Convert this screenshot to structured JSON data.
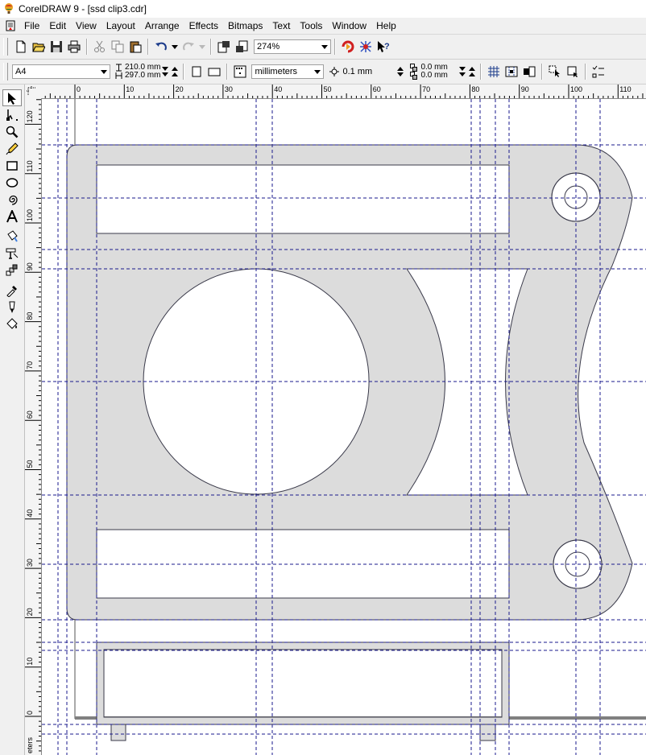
{
  "window": {
    "title": "CorelDRAW 9 - [ssd clip3.cdr]"
  },
  "menu": [
    "File",
    "Edit",
    "View",
    "Layout",
    "Arrange",
    "Effects",
    "Bitmaps",
    "Text",
    "Tools",
    "Window",
    "Help"
  ],
  "toolbar": {
    "zoom": "274%"
  },
  "property_bar": {
    "paper": "A4",
    "width": "210.0 mm",
    "height": "297.0 mm",
    "units": "millimeters",
    "nudge": "0.1 mm",
    "dup_x": "0.0 mm",
    "dup_y": "0.0 mm"
  },
  "rulers": {
    "h_labels": [
      "0",
      "10",
      "20",
      "30",
      "40",
      "50",
      "60",
      "70",
      "80",
      "90",
      "100",
      "110"
    ],
    "v_labels": [
      "120",
      "110",
      "100",
      "90",
      "80",
      "70",
      "60",
      "50",
      "40",
      "30",
      "20",
      "10",
      "0"
    ],
    "v_unit": "eters"
  },
  "icons": {
    "new": "new-document-icon",
    "open": "open-folder-icon",
    "save": "save-disk-icon",
    "print": "printer-icon",
    "cut": "scissors-icon",
    "copy": "copy-icon",
    "paste": "paste-icon",
    "undo": "undo-icon",
    "redo": "redo-icon",
    "import": "import-icon",
    "export": "export-icon",
    "launcher": "application-launcher-icon",
    "corel-online": "corel-online-icon",
    "whats-this": "whats-this-help-icon"
  },
  "colors": {
    "shape_fill": "#dcdcdc",
    "guides": "#1a1a8c",
    "outline": "#3a3a4a"
  }
}
